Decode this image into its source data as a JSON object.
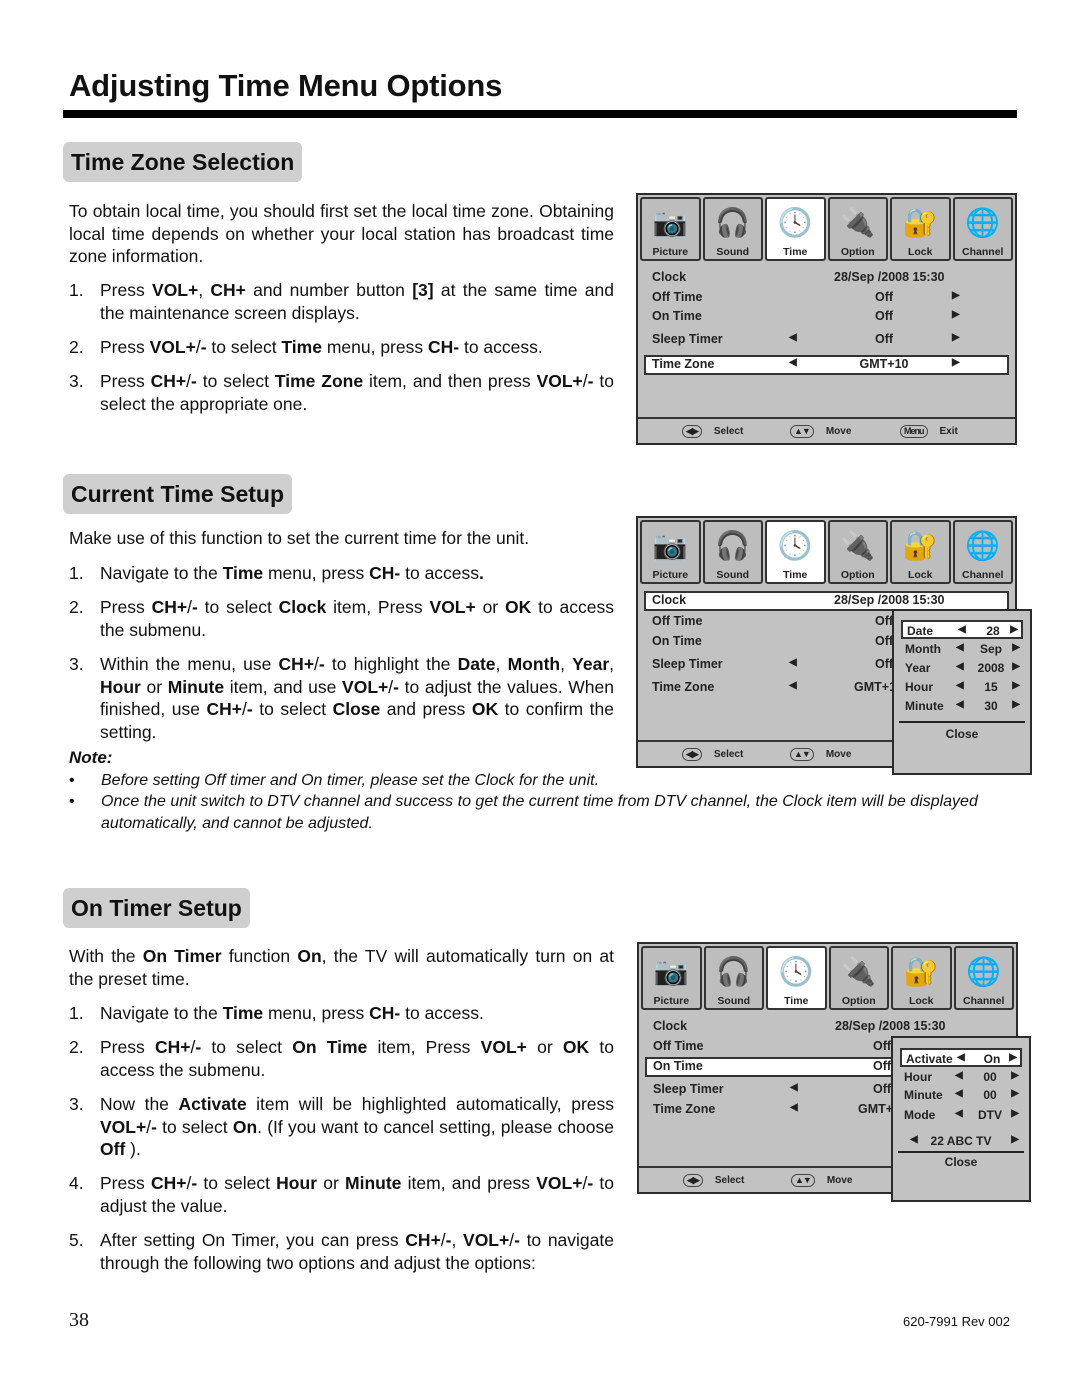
{
  "page": {
    "title": "Adjusting Time Menu Options",
    "page_number": "38",
    "revision": "620-7991 Rev 002"
  },
  "time_zone": {
    "heading": "Time Zone Selection",
    "intro": "To obtain local time, you should first set the local time zone. Obtaining local time depends on whether your local station has broadcast time zone information.",
    "steps": [
      {
        "num": "1.",
        "html": "Press <b>VOL+</b>, <b>CH+</b> and number button <b>[3]</b> at the same time and the maintenance screen displays."
      },
      {
        "num": "2.",
        "html": "Press <b>VOL+</b>/<b>-</b> to select <b>Time</b> menu, press <b>CH-</b> to access."
      },
      {
        "num": "3.",
        "html": "Press <b>CH+</b>/<b>-</b> to select <b>Time Zone</b> item, and then press <b>VOL+</b>/<b>-</b> to select the appropriate one."
      }
    ]
  },
  "current_time": {
    "heading": "Current Time Setup",
    "intro": "Make use of this function to set the current time for the unit.",
    "steps": [
      {
        "num": "1.",
        "html": "Navigate to the <b>Time</b> menu, press <b>CH-</b> to access<b>.</b>"
      },
      {
        "num": "2.",
        "html": "Press <b>CH+</b>/<b>-</b> to select <b>Clock</b> item, Press <b>VOL+</b> or <b>OK</b> to access the submenu."
      },
      {
        "num": "3.",
        "html": "Within the menu, use <b>CH+</b>/<b>-</b> to highlight the <b>Date</b>, <b>Month</b>, <b>Year</b>, <b>Hour</b> or <b>Minute</b> item, and use <b>VOL+</b>/<b>-</b> to adjust the values. When finished, use <b>CH+</b>/<b>-</b> to select <b>Close</b> and press <b>OK</b> to confirm the setting."
      }
    ],
    "note_label": "Note:",
    "notes": [
      "Before setting Off timer and On timer, please set the Clock for the unit.",
      "Once the unit switch to DTV channel and success to get the current time from DTV channel, the Clock item will be displayed automatically, and cannot be adjusted."
    ]
  },
  "on_timer": {
    "heading": "On Timer Setup",
    "intro_html": "With the <b>On Timer</b> function <b>On</b>, the TV will automatically turn on at the preset time.",
    "steps": [
      {
        "num": "1.",
        "html": "Navigate to the <b>Time</b> menu, press <b>CH-</b> to access."
      },
      {
        "num": "2.",
        "html": "Press <b>CH+</b>/<b>-</b> to select <b>On Time</b> item, Press <b>VOL+</b> or <b>OK</b> to access the submenu."
      },
      {
        "num": "3.",
        "html": "Now the <b>Activate</b> item will be highlighted automatically, press <b>VOL+</b>/<b>-</b> to select <b>On</b>. (If you want to cancel setting, please choose <b>Off</b> )."
      },
      {
        "num": "4.",
        "html": "Press <b>CH+</b>/<b>-</b> to select <b>Hour</b> or <b>Minute</b> item, and press <b>VOL+</b>/<b>-</b> to adjust the value."
      },
      {
        "num": "5.",
        "html": "After setting On Timer, you can press <b>CH+</b>/<b>-</b>, <b>VOL+</b>/<b>-</b> to navigate through the following two options and adjust the options:"
      }
    ]
  },
  "tv_menu": {
    "tabs": [
      {
        "label": "Picture",
        "icon": "camera-icon",
        "glyph": "📷"
      },
      {
        "label": "Sound",
        "icon": "headphones-icon",
        "glyph": "🎧"
      },
      {
        "label": "Time",
        "icon": "clock-icon",
        "glyph": "🕓"
      },
      {
        "label": "Option",
        "icon": "connector-icon",
        "glyph": "🔌"
      },
      {
        "label": "Lock",
        "icon": "lock-icon",
        "glyph": "🔐"
      },
      {
        "label": "Channel",
        "icon": "globe-icon",
        "glyph": "🌐"
      }
    ],
    "rows": {
      "clock": {
        "label": "Clock",
        "value": "28/Sep  /2008 15:30"
      },
      "off_time": {
        "label": "Off Time",
        "value": "Off"
      },
      "on_time": {
        "label": "On Time",
        "value": "Off"
      },
      "sleep_timer": {
        "label": "Sleep Timer",
        "value": "Off"
      },
      "time_zone": {
        "label": "Time Zone",
        "value": "GMT+10",
        "value_clipped": "GMT+1",
        "value_clipped2": "GMT+"
      }
    },
    "left_arrow": "◀",
    "right_arrow": "▶",
    "footer": {
      "select": "Select",
      "move": "Move",
      "exit": "Exit",
      "menu_key": "Menu",
      "lr_key": "◀▶",
      "ud_key": "▲▼"
    },
    "clock_popup": {
      "rows": [
        {
          "label": "Date",
          "value": "28"
        },
        {
          "label": "Month",
          "value": "Sep"
        },
        {
          "label": "Year",
          "value": "2008"
        },
        {
          "label": "Hour",
          "value": "15"
        },
        {
          "label": "Minute",
          "value": "30"
        }
      ],
      "close": "Close"
    },
    "on_timer_popup": {
      "rows": [
        {
          "label": "Activate",
          "value": "On"
        },
        {
          "label": "Hour",
          "value": "00"
        },
        {
          "label": "Minute",
          "value": "00"
        },
        {
          "label": "Mode",
          "value": "DTV"
        }
      ],
      "channel": "22 ABC TV",
      "close": "Close"
    }
  }
}
